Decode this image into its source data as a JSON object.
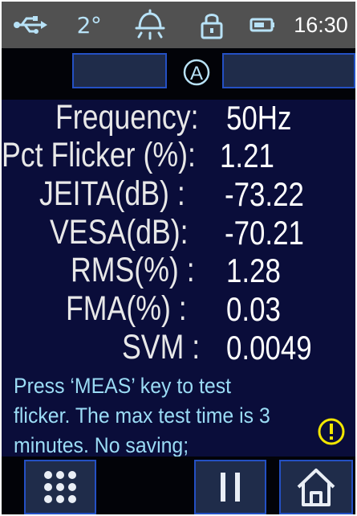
{
  "status_bar": {
    "icons": [
      "usb-icon",
      "thermometer-icon",
      "alarm-bell-icon",
      "lock-icon",
      "battery-icon"
    ],
    "temperature": "2°",
    "time": "16:30"
  },
  "top_bar": {
    "mode_symbol": "A",
    "icons": [
      "auto-mode-icon"
    ]
  },
  "readings": [
    {
      "label": "Frequency:",
      "value": "50Hz"
    },
    {
      "label": "Pct Flicker (%):",
      "value": "1.21"
    },
    {
      "label": "JEITA(dB) :",
      "value": "-73.22"
    },
    {
      "label": "VESA(dB):",
      "value": "-70.21"
    },
    {
      "label": "RMS(%) :",
      "value": "1.28"
    },
    {
      "label": "FMA(%) :",
      "value": "0.03"
    },
    {
      "label": "SVM :",
      "value": "0.0049"
    }
  ],
  "hint": {
    "lines": [
      "Press  ‘MEAS’  key to test",
      "flicker. The max test time is 3",
      "minutes. No saving;"
    ]
  },
  "bottom_bar": {
    "icons": [
      "menu-grid-icon",
      "pause-icon",
      "home-icon",
      "warning-icon"
    ]
  },
  "colors": {
    "background": "#0a0d3a",
    "status_bar": "#515151",
    "button_fill": "#1f2c4a",
    "button_border": "#2450c4",
    "hint_text": "#9bdcf5",
    "icon_light_blue": "#b8e2f7",
    "warning": "#f2e600"
  }
}
